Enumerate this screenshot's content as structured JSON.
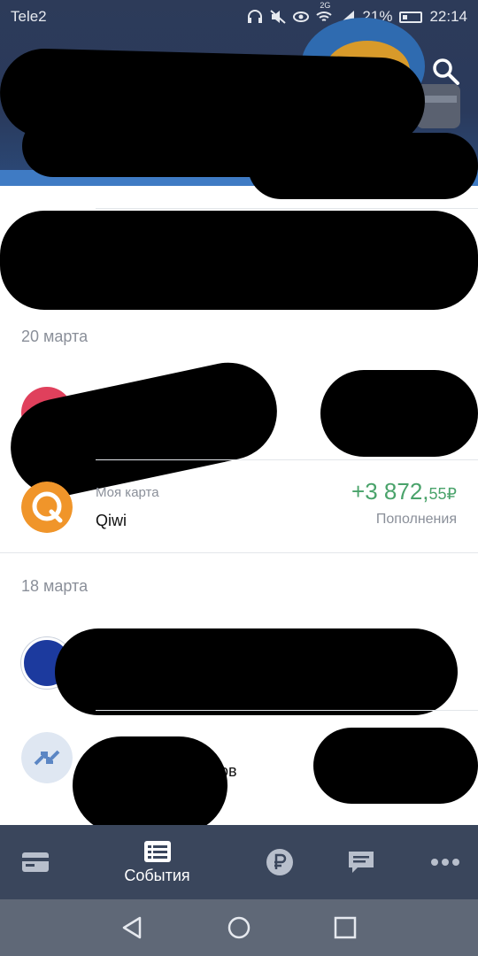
{
  "status_bar": {
    "carrier": "Tele2",
    "network": "2G",
    "battery_percent": "21%",
    "time": "22:14"
  },
  "header": {
    "search_icon": "search-icon"
  },
  "feed": {
    "sections": [
      {
        "date": "20 марта",
        "transactions": [
          {
            "icon": "pink-card-icon",
            "color": "#e0405c"
          },
          {
            "subtitle": "Моя карта",
            "title": "Qiwi",
            "amount_main": "+3 872,",
            "amount_cents": "55",
            "currency": "₽",
            "category": "Пополнения",
            "icon": "qiwi-icon",
            "color": "#f0952a"
          }
        ]
      },
      {
        "date": "18 марта",
        "transactions": [
          {
            "icon": "merchant-logo-icon",
            "color": "#1c3a9e"
          },
          {
            "icon": "transfer-arrows-icon",
            "color": "#dfe7f2",
            "title_partial": "тов"
          }
        ]
      }
    ]
  },
  "bottom_nav": {
    "items": [
      {
        "icon": "card-icon"
      },
      {
        "icon": "events-list-icon",
        "label": "События",
        "active": true
      },
      {
        "icon": "ruble-icon"
      },
      {
        "icon": "chat-icon"
      },
      {
        "icon": "more-icon"
      }
    ]
  },
  "colors": {
    "header": "#2d3b59",
    "accent": "#3f7bc4",
    "positive_amount": "#4aa36b",
    "nav_bg": "#3a465c"
  }
}
